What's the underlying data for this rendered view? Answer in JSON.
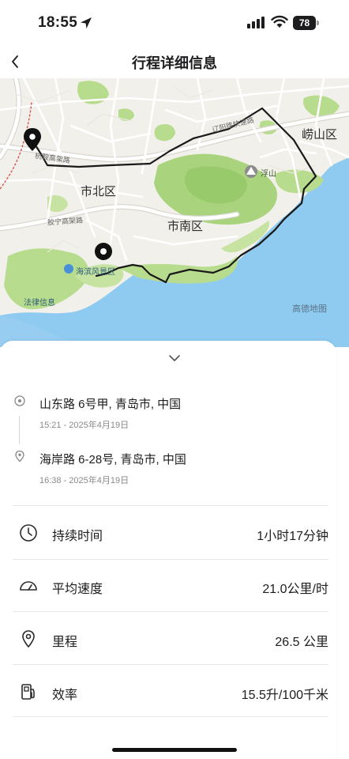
{
  "status_bar": {
    "time": "18:55",
    "battery": "78",
    "icons": [
      "location-arrow-icon",
      "cellular-signal-icon",
      "wifi-icon",
      "battery-icon"
    ]
  },
  "header": {
    "title": "行程详细信息",
    "back_icon": "chevron-left-icon"
  },
  "map": {
    "district_labels": [
      "市北区",
      "市南区",
      "崂山区"
    ],
    "road_labels": [
      "杭鞍高架路",
      "辽阳路快速路",
      "胶宁高架路"
    ],
    "poi_labels": [
      "浮山",
      "海滨风景区",
      "法律信息"
    ],
    "watermark": "高德地图",
    "colors": {
      "land": "#f2f0ea",
      "water": "#8fcaf0",
      "park": "#b8dc8e",
      "route": "#1a1a1a"
    }
  },
  "trip": {
    "collapse_icon": "chevron-down-icon",
    "start": {
      "address": "山东路 6号甲, 青岛市, 中国",
      "time": "15:21 - 2025年4月19日",
      "icon": "start-point-icon"
    },
    "end": {
      "address": "海岸路 6-28号, 青岛市, 中国",
      "time": "16:38 - 2025年4月19日",
      "icon": "location-pin-icon"
    }
  },
  "stats": [
    {
      "icon": "clock-icon",
      "label": "持续时间",
      "value": "1小时17分钟"
    },
    {
      "icon": "speedometer-icon",
      "label": "平均速度",
      "value": "21.0公里/时"
    },
    {
      "icon": "location-pin-icon",
      "label": "里程",
      "value": "26.5 公里"
    },
    {
      "icon": "fuel-pump-icon",
      "label": "效率",
      "value": "15.5升/100千米"
    }
  ]
}
